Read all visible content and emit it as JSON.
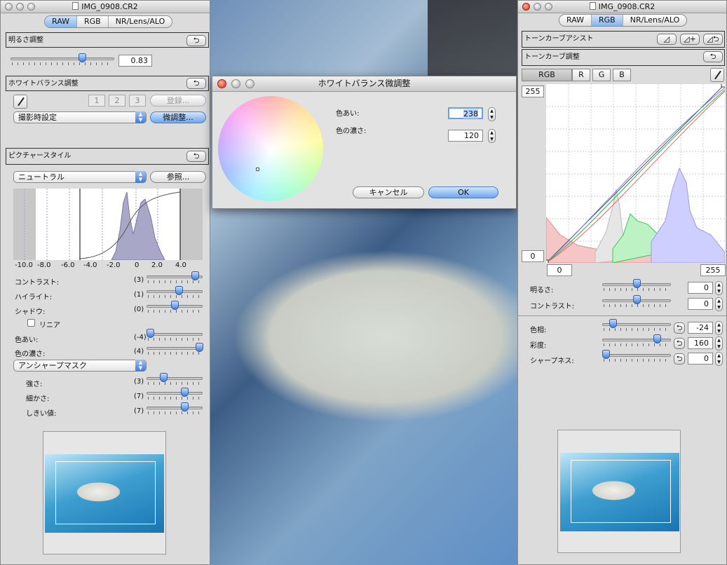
{
  "left": {
    "title": "IMG_0908.CR2",
    "tabs": [
      "RAW",
      "RGB",
      "NR/Lens/ALO"
    ],
    "brightness": {
      "label": "明るさ調整",
      "value": "0.83",
      "level": 0.5
    },
    "wb": {
      "label": "ホワイトバランス調整",
      "presets": [
        "1",
        "2",
        "3"
      ],
      "register": "登録...",
      "mode": "撮影時設定",
      "fine": "微調整..."
    },
    "ps": {
      "label": "ピクチャースタイル",
      "style": "ニュートラル",
      "browse": "参照...",
      "ticks": [
        "-10.0",
        "-8.0",
        "-6.0",
        "-4.0",
        "-2.0",
        "0",
        "2.0",
        "4.0"
      ],
      "rows": [
        {
          "label": "コントラスト:",
          "val": "(3)",
          "level": 0.86
        },
        {
          "label": "ハイライト:",
          "val": "(1)",
          "level": 0.58
        },
        {
          "label": "シャドウ:",
          "val": "(0)",
          "level": 0.5
        },
        {
          "label": "色あい:",
          "val": "(-4)",
          "level": 0.06
        },
        {
          "label": "色の濃さ:",
          "val": "(4)",
          "level": 0.94
        }
      ],
      "linear": "リニア",
      "usm": "アンシャープマスク",
      "usm_rows": [
        {
          "label": "強さ:",
          "val": "(3)",
          "level": 0.3
        },
        {
          "label": "細かさ:",
          "val": "(7)",
          "level": 0.68
        },
        {
          "label": "しきい値:",
          "val": "(7)",
          "level": 0.68
        }
      ]
    }
  },
  "dialog": {
    "title": "ホワイトバランス微調整",
    "hue_label": "色あい:",
    "hue_value": "238",
    "sat_label": "色の濃さ:",
    "sat_value": "120",
    "cancel": "キャンセル",
    "ok": "OK"
  },
  "right": {
    "title": "IMG_0908.CR2",
    "tabs": [
      "RAW",
      "RGB",
      "NR/Lens/ALO"
    ],
    "assist": "トーンカーブアシスト",
    "adjust": "トーンカーブ調整",
    "channels": [
      "RGB",
      "R",
      "G",
      "B"
    ],
    "curve_top": "255",
    "curve_left": "0",
    "curve_bottom_left": "0",
    "curve_bottom_right": "255",
    "rows": [
      {
        "label": "明るさ:",
        "value": "0",
        "level": 0.5
      },
      {
        "label": "コントラスト:",
        "value": "0",
        "level": 0.5
      }
    ],
    "rows2": [
      {
        "label": "色相:",
        "value": "-24",
        "level": 0.15
      },
      {
        "label": "彩度:",
        "value": "160",
        "level": 0.8
      },
      {
        "label": "シャープネス:",
        "value": "0",
        "level": 0.05
      }
    ]
  }
}
